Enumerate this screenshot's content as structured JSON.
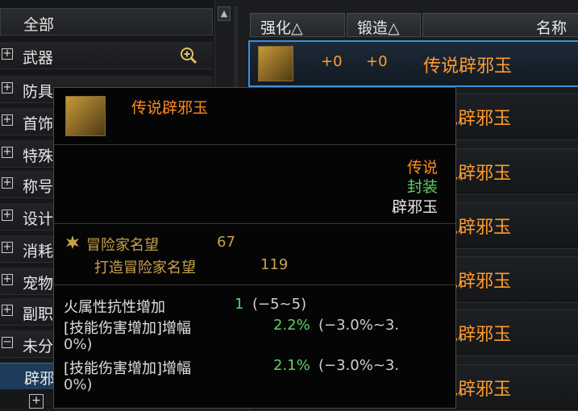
{
  "categories": {
    "all": "全部",
    "items": [
      {
        "label": "武器"
      },
      {
        "label": "防具"
      },
      {
        "label": "首饰"
      },
      {
        "label": "特殊"
      },
      {
        "label": "称号"
      },
      {
        "label": "设计"
      },
      {
        "label": "消耗"
      },
      {
        "label": "宠物"
      },
      {
        "label": "副职"
      },
      {
        "label": "未分"
      }
    ],
    "selected_sub": "辟邪玉"
  },
  "columns": {
    "enhance": "强化△",
    "forge": "锻造△",
    "name": "名称"
  },
  "rows": [
    {
      "enhance": "+0",
      "forge": "+0",
      "name": "传说辟邪玉"
    },
    {
      "name": "传说辟邪玉"
    },
    {
      "name": "传说辟邪玉"
    },
    {
      "name": "传说辟邪玉"
    },
    {
      "name": "传说辟邪玉"
    },
    {
      "name": "传说辟邪玉"
    },
    {
      "name": "传说辟邪玉"
    }
  ],
  "tooltip": {
    "title": "传说辟邪玉",
    "rarity": "传说",
    "bind": "封装",
    "type": "辟邪玉",
    "fame_label": "冒险家名望",
    "fame_value": "67",
    "craft_fame_label": "打造冒险家名望",
    "craft_fame_value": "119",
    "stat1_label": "火属性抗性增加",
    "stat1_value": "1",
    "stat1_range": "(−5~5)",
    "stat2_label": "[技能伤害增加]增幅",
    "stat2_value": "2.2%",
    "stat2_range": "(−3.0%~3.",
    "stat2_range_cont": "0%)",
    "stat3_label": "[技能伤害增加]增幅",
    "stat3_value": "2.1%",
    "stat3_range": "(−3.0%~3.",
    "stat3_range_cont": "0%)"
  },
  "colors": {
    "item_name": "#ff9a2e",
    "rarity": "#ff8a1e",
    "bind": "#5bd163",
    "fame": "#c9a24a",
    "selected_border": "#3d8fd6"
  }
}
